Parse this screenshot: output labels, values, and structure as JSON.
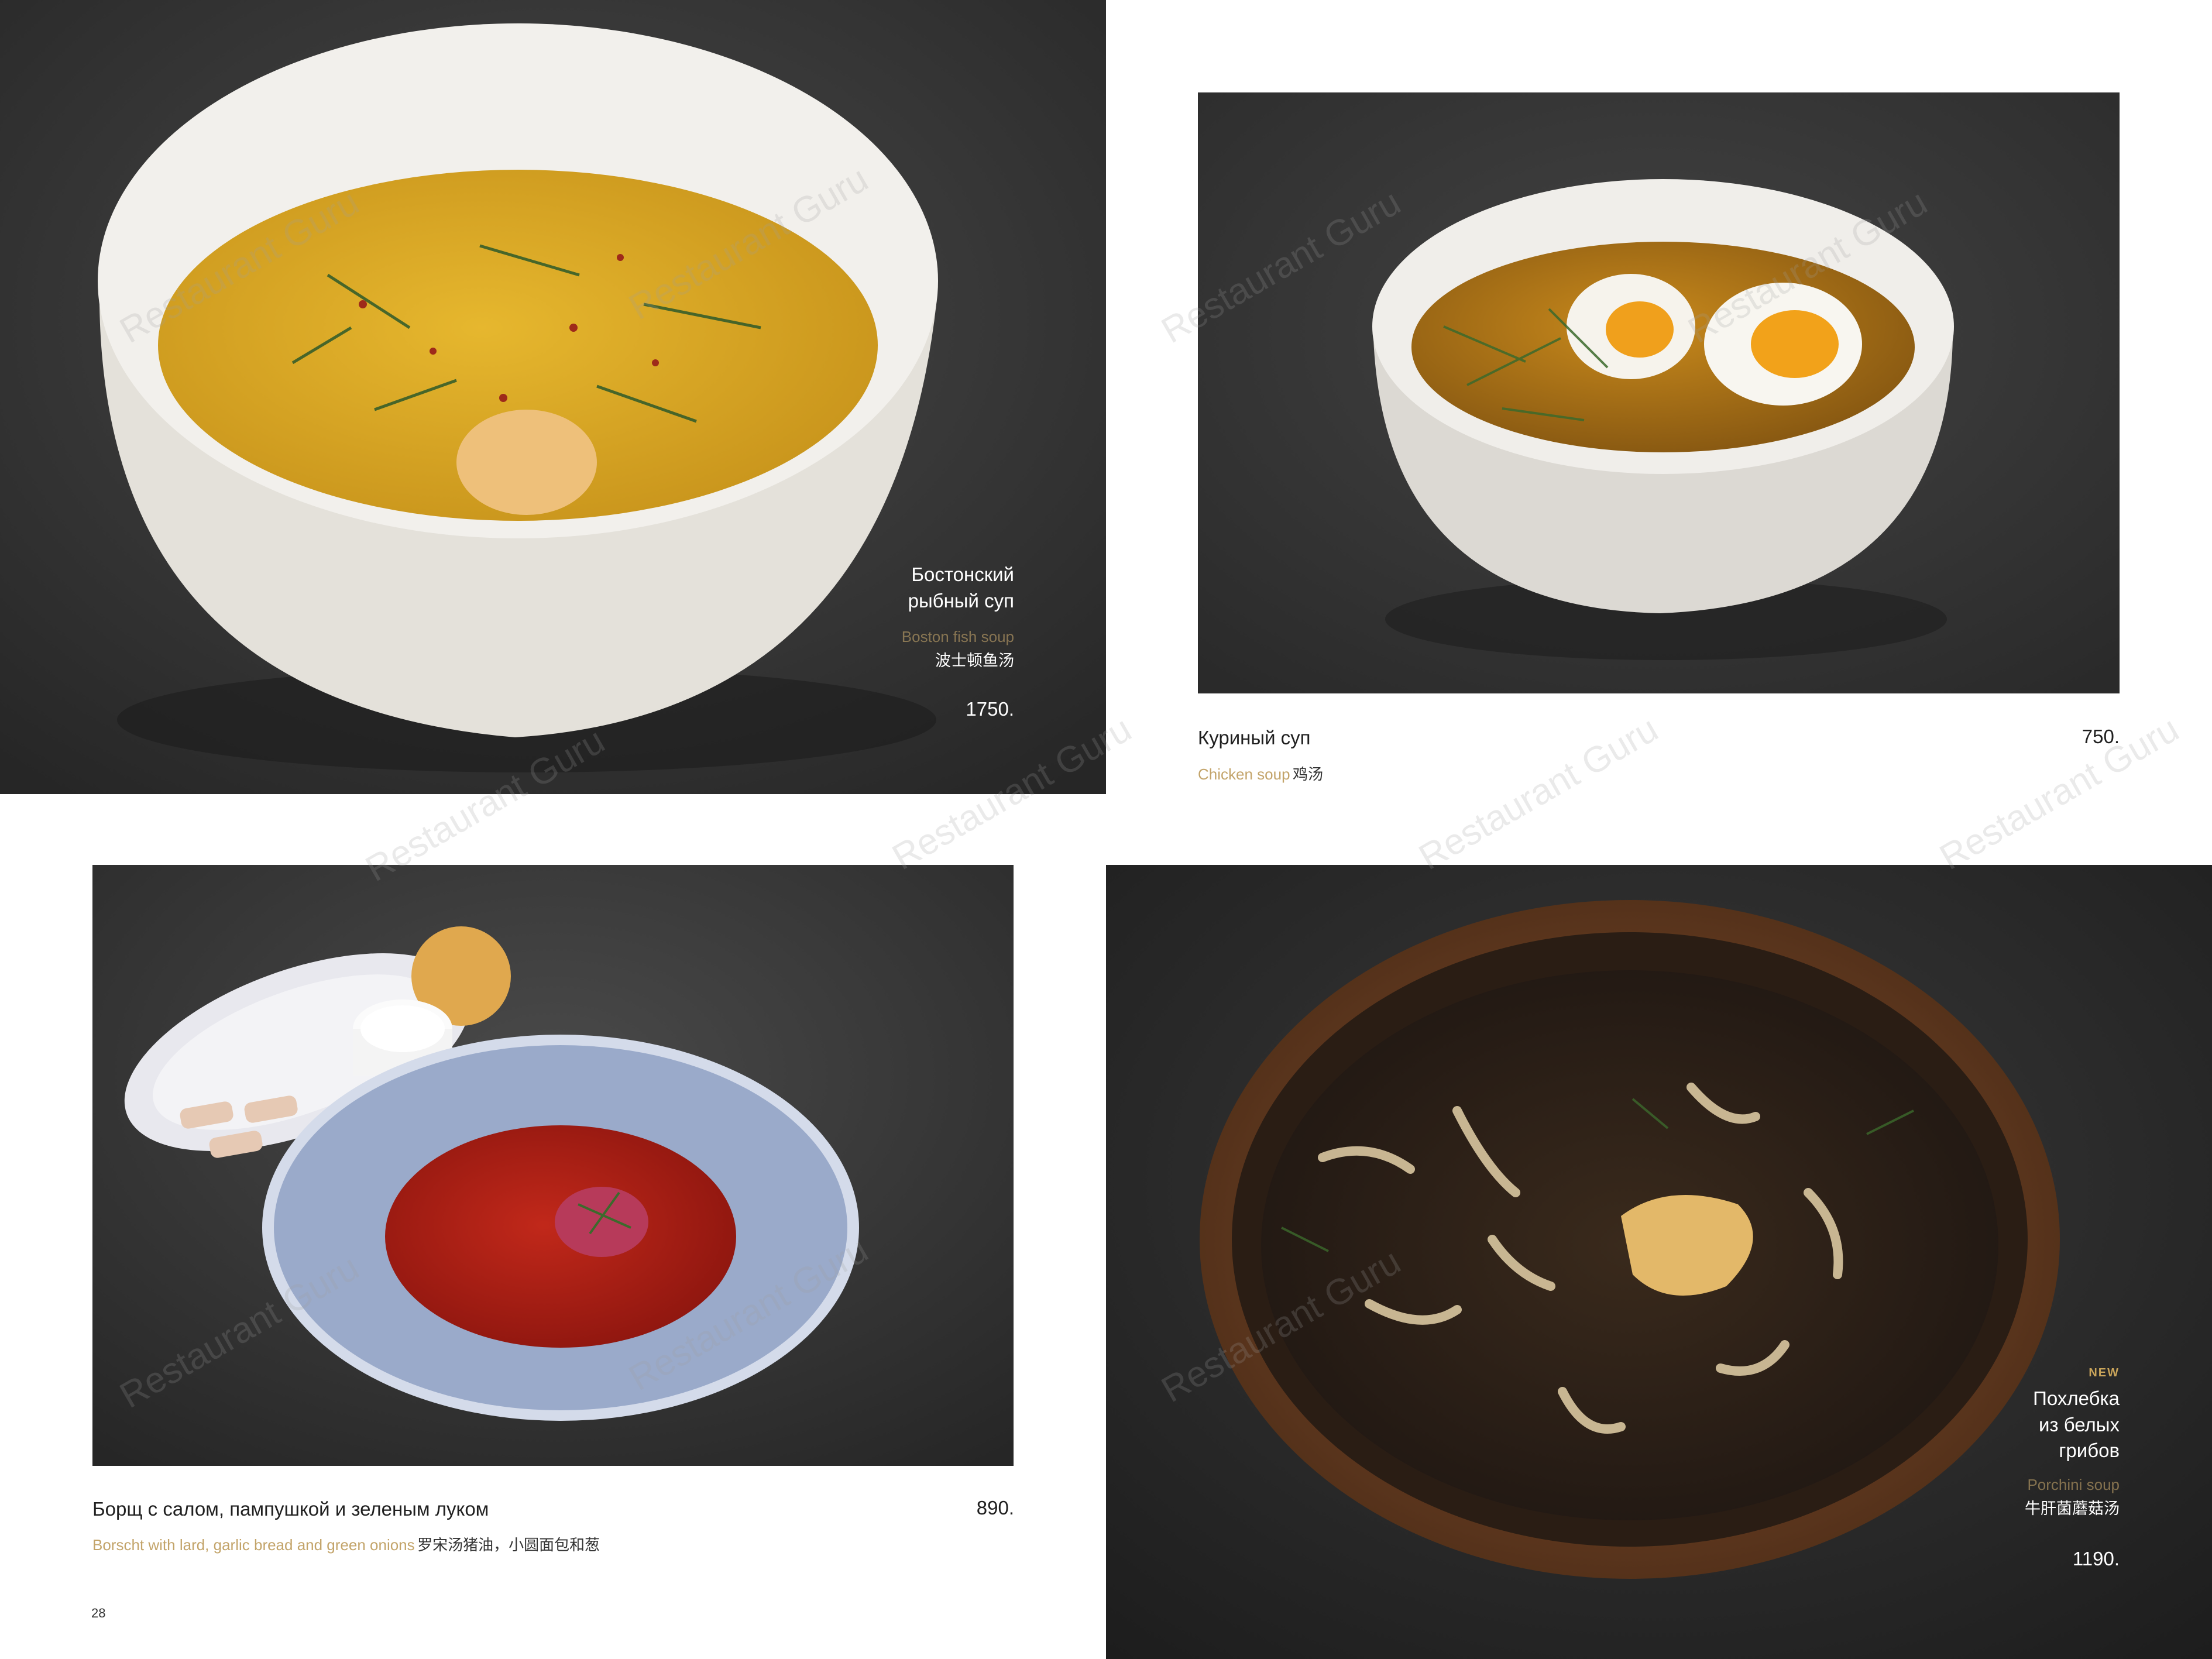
{
  "page_number": "28",
  "watermark": "Restaurant Guru",
  "dishes": [
    {
      "id": "boston",
      "name_line1": "Бостонский",
      "name_line2": "рыбный суп",
      "en": "Boston fish soup",
      "zh": "波士顿鱼汤",
      "price": "1750."
    },
    {
      "id": "chicken",
      "name": "Куриный суп",
      "en": "Chicken soup",
      "zh": "鸡汤",
      "price": "750."
    },
    {
      "id": "borscht",
      "name": "Борщ с салом, пампушкой и зеленым луком",
      "en": "Borscht with lard, garlic bread and green onions",
      "zh": "罗宋汤猪油，小圆面包和葱",
      "price": "890."
    },
    {
      "id": "porcini",
      "badge": "NEW",
      "name_line1": "Похлебка",
      "name_line2": "из белых",
      "name_line3": "грибов",
      "en": "Porchini soup",
      "zh": "牛肝菌蘑菇汤",
      "price": "1190."
    }
  ],
  "colors": {
    "accent_gold": "#c3a46a",
    "photo_background": "#3a3a3a",
    "text_dark": "#1f1f1f"
  }
}
